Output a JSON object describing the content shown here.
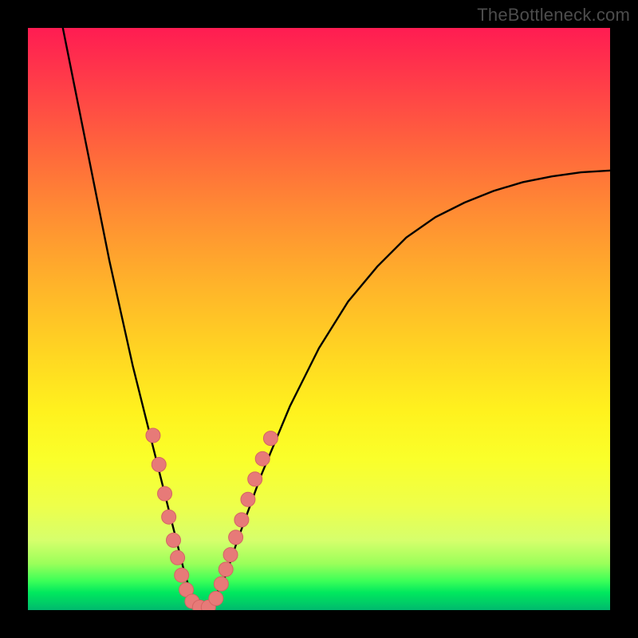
{
  "watermark": "TheBottleneck.com",
  "colors": {
    "frame": "#000000",
    "curve": "#000000",
    "marker_fill": "#e77a78",
    "marker_stroke": "#d46563"
  },
  "chart_data": {
    "type": "line",
    "title": "",
    "xlabel": "",
    "ylabel": "",
    "xlim": [
      0,
      100
    ],
    "ylim": [
      0,
      100
    ],
    "grid": false,
    "legend": false,
    "note": "Axes are unlabeled; values are estimated from pixel positions. x and y are in percent of the plot area (x left→right, y bottom→top).",
    "series": [
      {
        "name": "curve",
        "x": [
          6,
          8,
          10,
          12,
          14,
          16,
          18,
          20,
          22,
          23,
          24,
          25,
          26,
          27,
          28,
          30,
          32,
          34,
          36,
          40,
          45,
          50,
          55,
          60,
          65,
          70,
          75,
          80,
          85,
          90,
          95,
          100
        ],
        "y": [
          100,
          90,
          80,
          70,
          60,
          51,
          42,
          34,
          26,
          22,
          18,
          14,
          10,
          6,
          3,
          0,
          2,
          6,
          12,
          23,
          35,
          45,
          53,
          59,
          64,
          67.5,
          70,
          72,
          73.5,
          74.5,
          75.2,
          75.5
        ]
      }
    ],
    "markers": [
      {
        "x": 21.5,
        "y": 30
      },
      {
        "x": 22.5,
        "y": 25
      },
      {
        "x": 23.5,
        "y": 20
      },
      {
        "x": 24.2,
        "y": 16
      },
      {
        "x": 25.0,
        "y": 12
      },
      {
        "x": 25.7,
        "y": 9
      },
      {
        "x": 26.4,
        "y": 6
      },
      {
        "x": 27.2,
        "y": 3.5
      },
      {
        "x": 28.2,
        "y": 1.5
      },
      {
        "x": 29.5,
        "y": 0.5
      },
      {
        "x": 31.0,
        "y": 0.5
      },
      {
        "x": 32.3,
        "y": 2
      },
      {
        "x": 33.2,
        "y": 4.5
      },
      {
        "x": 34.0,
        "y": 7
      },
      {
        "x": 34.8,
        "y": 9.5
      },
      {
        "x": 35.7,
        "y": 12.5
      },
      {
        "x": 36.7,
        "y": 15.5
      },
      {
        "x": 37.8,
        "y": 19
      },
      {
        "x": 39.0,
        "y": 22.5
      },
      {
        "x": 40.3,
        "y": 26
      },
      {
        "x": 41.7,
        "y": 29.5
      }
    ]
  }
}
